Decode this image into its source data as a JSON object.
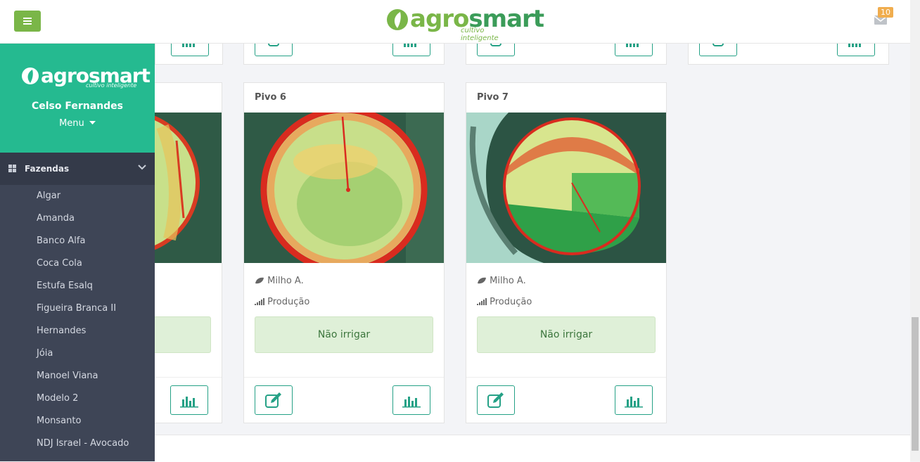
{
  "header": {
    "logo_agro": "agro",
    "logo_smart": "smart",
    "tagline": "cultivo inteligente",
    "notification_count": "10"
  },
  "sidebar": {
    "logo_agro": "agro",
    "logo_smart": "smart",
    "tagline": "cultivo inteligente",
    "user_name": "Celso Fernandes",
    "menu_label": "Menu",
    "section_label": "Fazendas",
    "items": [
      "Algar",
      "Amanda",
      "Banco Alfa",
      "Coca Cola",
      "Estufa Esalq",
      "Figueira Branca II",
      "Hernandes",
      "Jóia",
      "Manoel Viana",
      "Modelo 2",
      "Monsanto",
      "NDJ Israel - Avocado"
    ]
  },
  "cards": [
    {
      "title": "Pivo 6",
      "crop": "Milho A.",
      "phase": "Produção",
      "status": "Não irrigar"
    },
    {
      "title": "Pivo 7",
      "crop": "Milho A.",
      "phase": "Produção",
      "status": "Não irrigar"
    }
  ],
  "colors": {
    "brand_green": "#7ab648",
    "teal": "#25ba90",
    "sidebar_bg": "#3e4556"
  }
}
